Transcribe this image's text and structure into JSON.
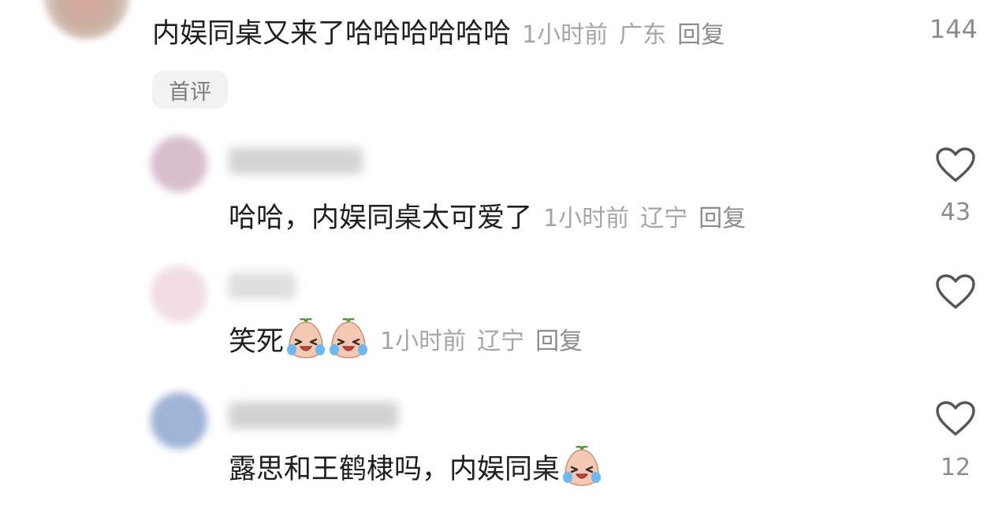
{
  "top_comment": {
    "text": "内娱同桌又来了哈哈哈哈哈哈",
    "time": "1小时前",
    "location": "广东",
    "reply_label": "回复",
    "like_count": "144",
    "badge": "首评"
  },
  "replies": [
    {
      "text": "哈哈，内娱同桌太可爱了",
      "time": "1小时前",
      "location": "辽宁",
      "reply_label": "回复",
      "like_count": "43",
      "emoji_count": 0,
      "avatar_color": "#d9bfcd"
    },
    {
      "text": "笑死",
      "time": "1小时前",
      "location": "辽宁",
      "reply_label": "回复",
      "like_count": "",
      "emoji_count": 2,
      "avatar_color": "#f1dde2"
    },
    {
      "text": "露思和王鹤棣吗，内娱同桌",
      "time": "",
      "location": "",
      "reply_label": "",
      "like_count": "12",
      "emoji_count": 1,
      "avatar_color": "#9fb3d6"
    }
  ],
  "icons": {
    "like": "heart-outline-icon",
    "emoji": "laughing-crying-emoji-icon"
  },
  "colors": {
    "primary_text": "#1f1f1f",
    "meta_text": "#a6a6a6",
    "icon_stroke": "#555555",
    "badge_bg": "#f2f2f2"
  }
}
